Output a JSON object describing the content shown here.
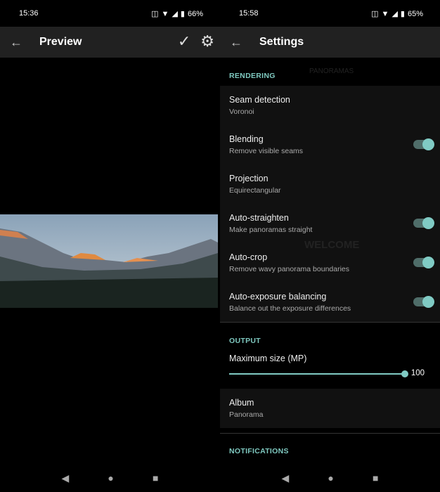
{
  "left": {
    "status": {
      "time": "15:36",
      "battery": "66%"
    },
    "toolbar": {
      "title": "Preview",
      "confirm_icon": "check-icon",
      "settings_icon": "gear-icon"
    }
  },
  "right": {
    "status": {
      "time": "15:58",
      "battery": "65%"
    },
    "toolbar": {
      "title": "Settings"
    },
    "ghost": {
      "tab": "PANORAMAS",
      "welcome": "WELCOME"
    },
    "sections": {
      "rendering": {
        "header": "RENDERING",
        "items": [
          {
            "title": "Seam detection",
            "summary": "Voronoi"
          },
          {
            "title": "Blending",
            "summary": "Remove visible seams",
            "toggle": true
          },
          {
            "title": "Projection",
            "summary": "Equirectangular"
          },
          {
            "title": "Auto-straighten",
            "summary": "Make panoramas straight",
            "toggle": true
          },
          {
            "title": "Auto-crop",
            "summary": "Remove wavy panorama boundaries",
            "toggle": true
          },
          {
            "title": "Auto-exposure balancing",
            "summary": "Balance out the exposure differences",
            "toggle": true
          }
        ]
      },
      "output": {
        "header": "OUTPUT",
        "max_size": {
          "title": "Maximum size (MP)",
          "value": "100",
          "fraction": 1.0
        },
        "album": {
          "title": "Album",
          "summary": "Panorama"
        }
      },
      "notifications": {
        "header": "NOTIFICATIONS"
      }
    }
  },
  "accent": "#80cbc4"
}
